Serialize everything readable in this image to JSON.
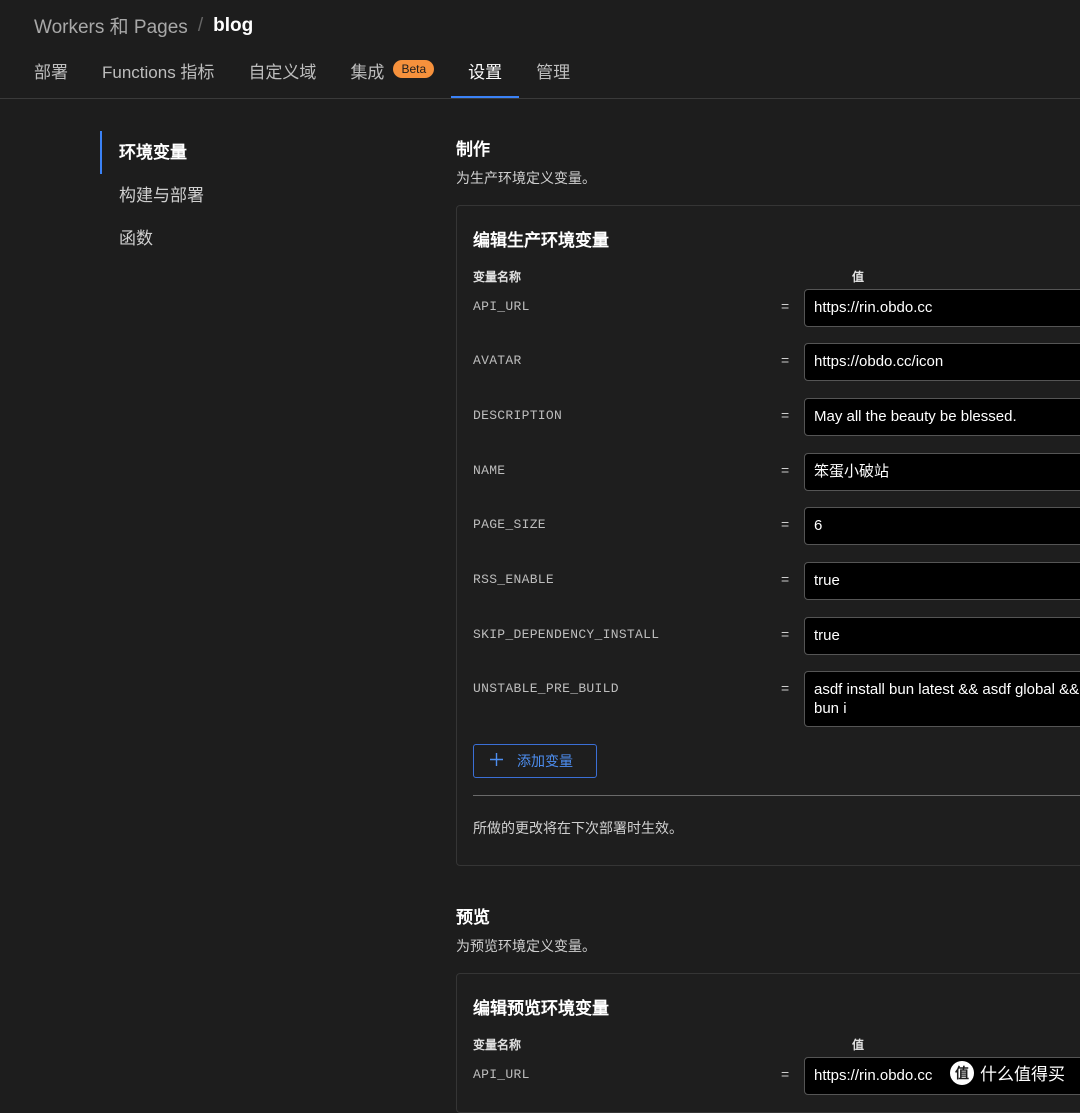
{
  "breadcrumb": {
    "parent": "Workers 和 Pages",
    "separator": "/",
    "current": "blog"
  },
  "tabs": [
    {
      "label": "部署"
    },
    {
      "label": "Functions 指标"
    },
    {
      "label": "自定义域"
    },
    {
      "label": "集成",
      "badge": "Beta"
    },
    {
      "label": "设置",
      "active": true
    },
    {
      "label": "管理"
    }
  ],
  "sidenav": {
    "items": [
      "环境变量",
      "构建与部署",
      "函数"
    ],
    "active_index": 0
  },
  "production": {
    "title": "制作",
    "description": "为生产环境定义变量。",
    "card_title": "编辑生产环境变量",
    "col_name": "变量名称",
    "col_value": "值",
    "vars": [
      {
        "name": "API_URL",
        "value": "https://rin.obdo.cc"
      },
      {
        "name": "AVATAR",
        "value": "https://obdo.cc/icon"
      },
      {
        "name": "DESCRIPTION",
        "value": "May all the beauty be blessed."
      },
      {
        "name": "NAME",
        "value": "笨蛋小破站"
      },
      {
        "name": "PAGE_SIZE",
        "value": "6"
      },
      {
        "name": "RSS_ENABLE",
        "value": "true"
      },
      {
        "name": "SKIP_DEPENDENCY_INSTALL",
        "value": "true"
      },
      {
        "name": "UNSTABLE_PRE_BUILD",
        "value": "asdf install bun latest && asdf global && bun i"
      }
    ],
    "add_button": "添加变量",
    "footnote": "所做的更改将在下次部署时生效。"
  },
  "preview": {
    "title": "预览",
    "description": "为预览环境定义变量。",
    "card_title": "编辑预览环境变量",
    "col_name": "变量名称",
    "col_value": "值",
    "vars": [
      {
        "name": "API_URL",
        "value": "https://rin.obdo.cc"
      }
    ]
  },
  "watermark": {
    "logo": "值",
    "text": "什么值得买"
  },
  "equals": "=",
  "icons": {
    "add": "plus-icon"
  },
  "colors": {
    "accent": "#3b82f6",
    "badge": "#f6913c",
    "background": "#1d1d1d"
  }
}
